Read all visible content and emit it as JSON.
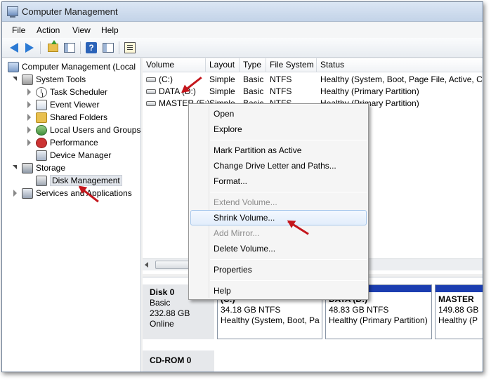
{
  "window": {
    "title": "Computer Management"
  },
  "menubar": {
    "items": [
      "File",
      "Action",
      "View",
      "Help"
    ]
  },
  "toolbar": {
    "buttons": [
      "back-arrow-icon",
      "forward-arrow-icon",
      "up-folder-icon",
      "show-hide-tree-icon",
      "help-icon",
      "show-action-pane-icon",
      "properties-icon"
    ]
  },
  "tree": {
    "items": [
      {
        "label": "Computer Management (Local",
        "icon": "computer-icon",
        "expander": "none"
      },
      {
        "label": "System Tools",
        "icon": "tools-icon",
        "expander": "open"
      },
      {
        "label": "Task Scheduler",
        "icon": "clock-icon",
        "expander": "closed"
      },
      {
        "label": "Event Viewer",
        "icon": "event-viewer-icon",
        "expander": "closed"
      },
      {
        "label": "Shared Folders",
        "icon": "shared-folder-icon",
        "expander": "closed"
      },
      {
        "label": "Local Users and Groups",
        "icon": "users-icon",
        "expander": "closed"
      },
      {
        "label": "Performance",
        "icon": "performance-icon",
        "expander": "closed"
      },
      {
        "label": "Device Manager",
        "icon": "device-manager-icon",
        "expander": "none"
      },
      {
        "label": "Storage",
        "icon": "storage-icon",
        "expander": "open"
      },
      {
        "label": "Disk Management",
        "icon": "disk-icon",
        "expander": "none",
        "selected": true
      },
      {
        "label": "Services and Applications",
        "icon": "services-icon",
        "expander": "closed"
      }
    ]
  },
  "volume_list": {
    "columns": [
      "Volume",
      "Layout",
      "Type",
      "File System",
      "Status"
    ],
    "rows": [
      {
        "volume": "(C:)",
        "layout": "Simple",
        "type": "Basic",
        "fs": "NTFS",
        "status": "Healthy (System, Boot, Page File, Active, Cr"
      },
      {
        "volume": "DATA (D:)",
        "layout": "Simple",
        "type": "Basic",
        "fs": "NTFS",
        "status": "Healthy (Primary Partition)"
      },
      {
        "volume": "MASTER (E:)",
        "layout": "Simple",
        "type": "Basic",
        "fs": "NTFS",
        "status": "Healthy (Primary Partition)"
      }
    ]
  },
  "context_menu": {
    "items": [
      {
        "label": "Open",
        "disabled": false
      },
      {
        "label": "Explore",
        "disabled": false
      },
      {
        "label": "Mark Partition as Active",
        "disabled": false
      },
      {
        "label": "Change Drive Letter and Paths...",
        "disabled": false
      },
      {
        "label": "Format...",
        "disabled": false
      },
      {
        "label": "Extend Volume...",
        "disabled": true
      },
      {
        "label": "Shrink Volume...",
        "disabled": false,
        "highlighted": true
      },
      {
        "label": "Add Mirror...",
        "disabled": true
      },
      {
        "label": "Delete Volume...",
        "disabled": false
      },
      {
        "label": "Properties",
        "disabled": false
      },
      {
        "label": "Help",
        "disabled": false
      }
    ]
  },
  "disk_map": {
    "disk0": {
      "name": "Disk 0",
      "type": "Basic",
      "size": "232.88 GB",
      "state": "Online"
    },
    "partitions": [
      {
        "name": "(C:)",
        "size": "34.18 GB NTFS",
        "status": "Healthy (System, Boot, Pa"
      },
      {
        "name": "DATA  (D:)",
        "size": "48.83 GB NTFS",
        "status": "Healthy (Primary Partition)"
      },
      {
        "name": "MASTER",
        "size": "149.88 GB",
        "status": "Healthy (P"
      }
    ],
    "cdrom": {
      "name": "CD-ROM 0"
    }
  },
  "colors": {
    "partition_bar": "#1b3db0",
    "annotation_arrow": "#c4161c",
    "menu_highlight": "#e2edfb"
  }
}
